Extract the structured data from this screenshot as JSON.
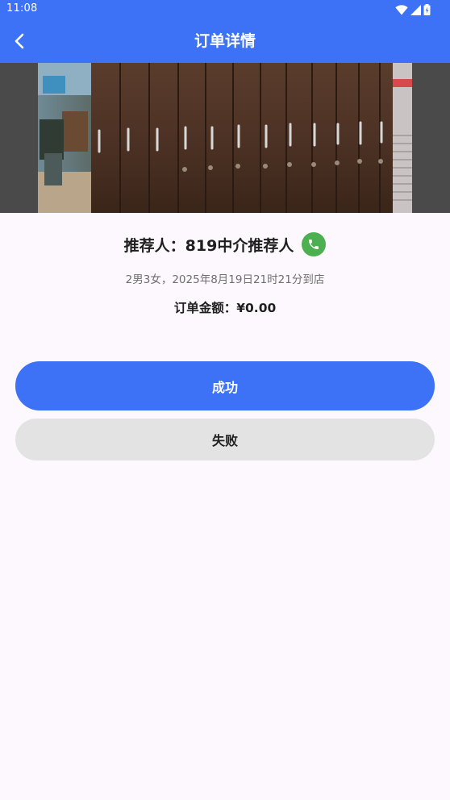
{
  "status_bar": {
    "time": "11:08"
  },
  "header": {
    "title": "订单详情",
    "background_color": "#3d72f7"
  },
  "order": {
    "referrer": "推荐人：819中介推荐人",
    "details": "2男3女，2025年8月19日21时21分到店",
    "amount": "订单金额：¥0.00"
  },
  "actions": {
    "success_label": "成功",
    "fail_label": "失败"
  },
  "colors": {
    "primary": "#3d72f7",
    "phone_green": "#4caf50",
    "page_background": "#fdf7fe",
    "secondary_button": "#e3e3e3"
  },
  "icons": {
    "back": "chevron-left-icon",
    "phone": "phone-icon",
    "wifi": "wifi-icon",
    "signal": "signal-icon",
    "battery": "battery-icon"
  }
}
